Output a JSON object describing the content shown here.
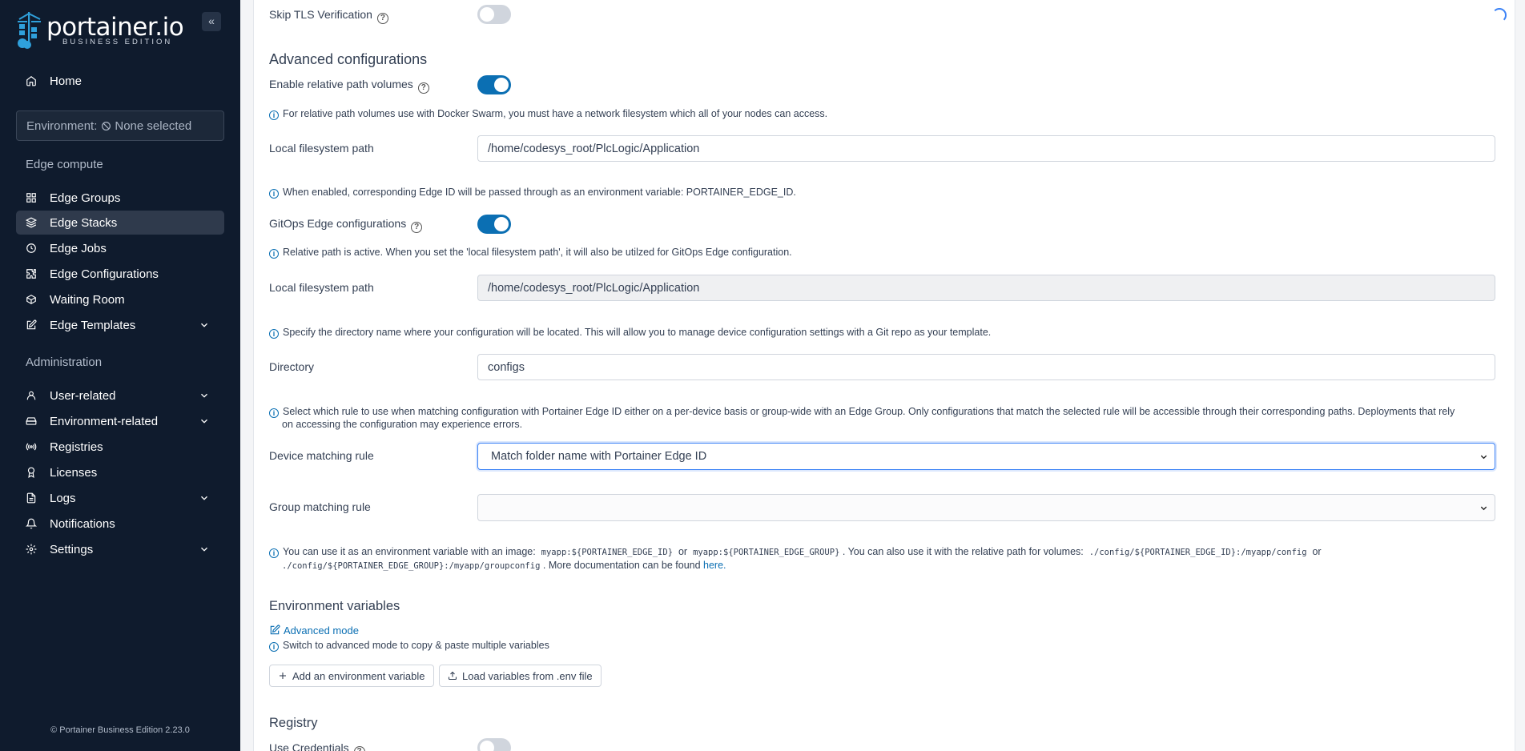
{
  "sidebar": {
    "logo_text": "portainer.io",
    "logo_sub": "BUSINESS EDITION",
    "collapse_glyph": "«",
    "home": "Home",
    "environment_prefix": "Environment:",
    "environment_value": "None selected",
    "edge_compute_label": "Edge compute",
    "edge_items": [
      {
        "label": "Edge Groups",
        "icon": "grid-icon"
      },
      {
        "label": "Edge Stacks",
        "icon": "layers-icon",
        "active": true
      },
      {
        "label": "Edge Jobs",
        "icon": "clock-icon"
      },
      {
        "label": "Edge Configurations",
        "icon": "puzzle-icon"
      },
      {
        "label": "Waiting Room",
        "icon": "box-icon"
      },
      {
        "label": "Edge Templates",
        "icon": "edit-icon",
        "expandable": true
      }
    ],
    "administration_label": "Administration",
    "admin_items": [
      {
        "label": "User-related",
        "icon": "user-icon",
        "expandable": true
      },
      {
        "label": "Environment-related",
        "icon": "hdd-icon",
        "expandable": true
      },
      {
        "label": "Registries",
        "icon": "radio-icon"
      },
      {
        "label": "Licenses",
        "icon": "award-icon"
      },
      {
        "label": "Logs",
        "icon": "file-icon",
        "expandable": true
      },
      {
        "label": "Notifications",
        "icon": "bell-icon"
      },
      {
        "label": "Settings",
        "icon": "settings-icon",
        "expandable": true
      }
    ],
    "footer": "© Portainer Business Edition 2.23.0"
  },
  "form": {
    "skip_tls_label": "Skip TLS Verification",
    "advanced_title": "Advanced configurations",
    "relative_path_label": "Enable relative path volumes",
    "relative_path_info": "For relative path volumes use with Docker Swarm, you must have a network filesystem which all of your nodes can access.",
    "local_fs_label": "Local filesystem path",
    "local_fs_value": "/home/codesys_root/PlcLogic/Application",
    "edge_id_info": "When enabled, corresponding Edge ID will be passed through as an environment variable: PORTAINER_EDGE_ID.",
    "gitops_label": "GitOps Edge configurations",
    "gitops_info": "Relative path is active. When you set the 'local filesystem path', it will also be utilzed for GitOps Edge configuration.",
    "local_fs_label_2": "Local filesystem path",
    "local_fs_value_2": "/home/codesys_root/PlcLogic/Application",
    "directory_info": "Specify the directory name where your configuration will be located. This will allow you to manage device configuration settings with a Git repo as your template.",
    "directory_label": "Directory",
    "directory_value": "configs",
    "rule_info_1": "Select which rule to use when matching configuration with Portainer Edge ID either on a per-device basis or group-wide with an Edge Group. Only configurations that match the selected rule will be accessible through their corresponding paths. Deployments that rely",
    "rule_info_2": "on accessing the configuration may experience errors.",
    "device_rule_label": "Device matching rule",
    "device_rule_value": "Match folder name with Portainer Edge ID",
    "group_rule_label": "Group matching rule",
    "group_rule_value": "",
    "usage_1": "You can use it as an environment variable with an image:",
    "usage_code_1": "myapp:${PORTAINER_EDGE_ID}",
    "usage_or_1": "or",
    "usage_code_2": "myapp:${PORTAINER_EDGE_GROUP}",
    "usage_2": ". You can also use it with the relative path for volumes:",
    "usage_code_3": "./config/${PORTAINER_EDGE_ID}:/myapp/config",
    "usage_or_2": "or",
    "usage_code_4": "./config/${PORTAINER_EDGE_GROUP}:/myapp/groupconfig",
    "usage_3": ". More documentation can be found",
    "usage_link": "here.",
    "env_title": "Environment variables",
    "advanced_mode": "Advanced mode",
    "advanced_mode_info": "Switch to advanced mode to copy & paste multiple variables",
    "add_env_btn": "Add an environment variable",
    "load_env_btn": "Load variables from .env file",
    "registry_title": "Registry",
    "use_credentials_label": "Use Credentials"
  },
  "colors": {
    "sidebar_bg": "#0f1b2d",
    "accent": "#0b6fb3",
    "focus": "#3b82f6"
  }
}
